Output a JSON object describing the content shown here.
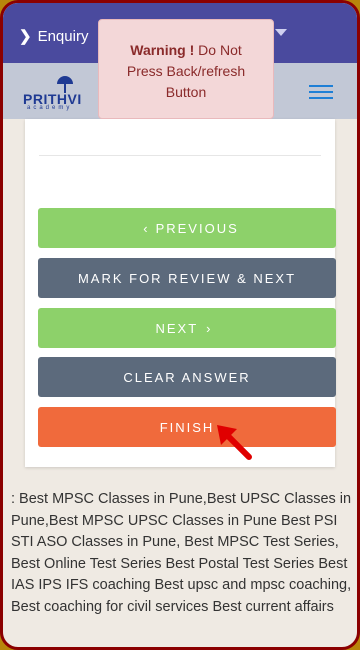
{
  "top_bar": {
    "enquiry_label": "Enquiry",
    "dropdown_icon": "caret-down-icon"
  },
  "header": {
    "logo_text": "PRITHVI",
    "logo_sub": "academy",
    "menu_icon": "hamburger-menu-icon"
  },
  "warning": {
    "title": "Warning !",
    "message": "Do Not Press Back/refresh Button"
  },
  "buttons": {
    "previous": {
      "label": "PREVIOUS",
      "icon": "chevron-left-icon"
    },
    "mark_review": {
      "label": "MARK FOR REVIEW & NEXT"
    },
    "next": {
      "label": "NEXT",
      "icon": "chevron-right-icon"
    },
    "clear": {
      "label": "CLEAR ANSWER"
    },
    "finish": {
      "label": "FINISH"
    }
  },
  "annotation": {
    "icon": "red-pointer-arrow-icon"
  },
  "seo_text": ": Best MPSC Classes in Pune,Best UPSC Classes in Pune,Best MPSC UPSC Classes in Pune Best PSI STI ASO Classes in Pune, Best MPSC Test Series, Best Online Test Series Best Postal Test Series Best IAS IPS IFS coaching Best upsc and mpsc coaching, Best coaching for civil services Best current affairs",
  "colors": {
    "top_bar": "#4a4a9e",
    "header": "#c2c8d6",
    "green_button": "#8dd16a",
    "slate_button": "#5c6a7c",
    "finish_button": "#f06a3c",
    "warning_bg": "#f3d7d8",
    "frame_border": "#8b0000"
  }
}
